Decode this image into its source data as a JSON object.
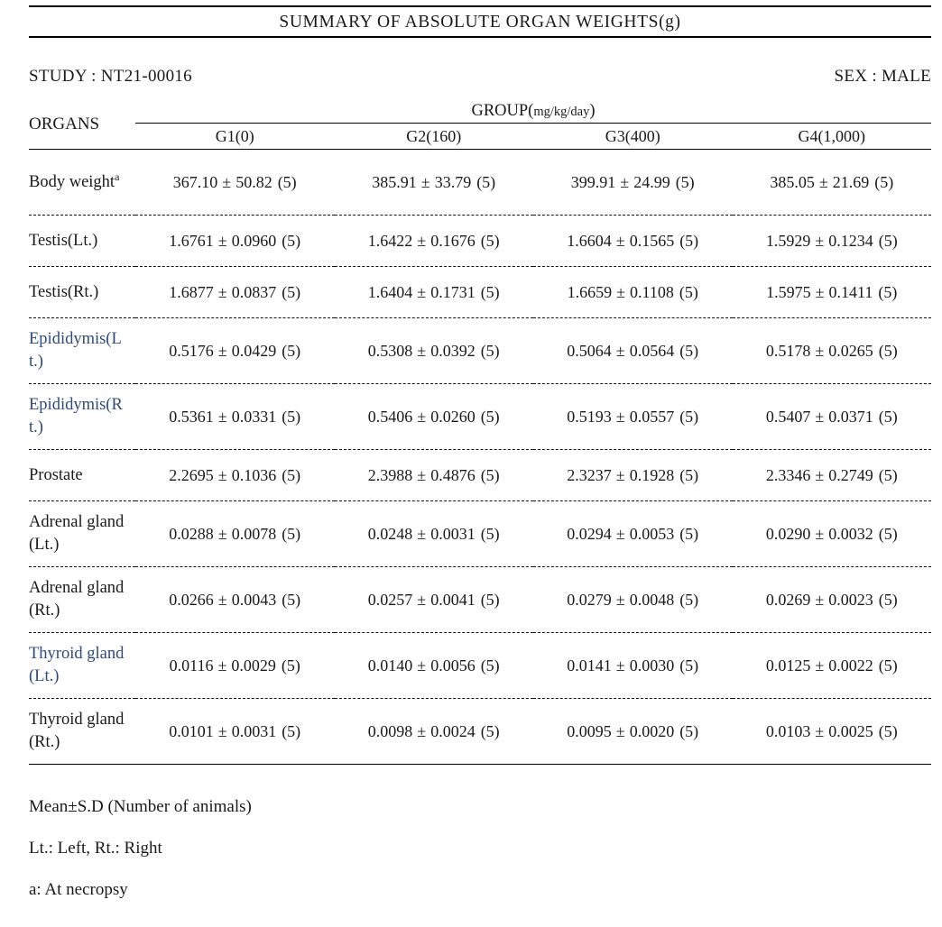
{
  "title": "SUMMARY  OF  ABSOLUTE  ORGAN  WEIGHTS(g)",
  "header": {
    "study_label": "STUDY : NT21-00016",
    "sex_label": "SEX : MALE",
    "organs_label": "ORGANS",
    "group_label": "GROUP(",
    "group_unit": "mg/kg/day",
    "group_label_end": ")",
    "columns": [
      "G1(0)",
      "G2(160)",
      "G3(400)",
      "G4(1,000)"
    ]
  },
  "colors": {
    "highlight_blue": "#2e4a7d",
    "text": "#1a1a1a"
  },
  "table": {
    "rows": [
      {
        "organ": "Body weight",
        "superscript": "a",
        "highlight": false,
        "values": [
          {
            "mean": "367.10",
            "pm": "±",
            "sd": "50.82",
            "n": "(5)"
          },
          {
            "mean": "385.91",
            "pm": "±",
            "sd": "33.79",
            "n": "(5)"
          },
          {
            "mean": "399.91",
            "pm": "±",
            "sd": "24.99",
            "n": "(5)"
          },
          {
            "mean": "385.05",
            "pm": "±",
            "sd": "21.69",
            "n": "(5)"
          }
        ]
      },
      {
        "organ": "Testis(Lt.)",
        "superscript": "",
        "highlight": false,
        "values": [
          {
            "mean": "1.6761",
            "pm": "±",
            "sd": "0.0960",
            "n": "(5)"
          },
          {
            "mean": "1.6422",
            "pm": "±",
            "sd": "0.1676",
            "n": "(5)"
          },
          {
            "mean": "1.6604",
            "pm": "±",
            "sd": "0.1565",
            "n": "(5)"
          },
          {
            "mean": "1.5929",
            "pm": "±",
            "sd": "0.1234",
            "n": "(5)"
          }
        ]
      },
      {
        "organ": "Testis(Rt.)",
        "superscript": "",
        "highlight": false,
        "values": [
          {
            "mean": "1.6877",
            "pm": "±",
            "sd": "0.0837",
            "n": "(5)"
          },
          {
            "mean": "1.6404",
            "pm": "±",
            "sd": "0.1731",
            "n": "(5)"
          },
          {
            "mean": "1.6659",
            "pm": "±",
            "sd": "0.1108",
            "n": "(5)"
          },
          {
            "mean": "1.5975",
            "pm": "±",
            "sd": "0.1411",
            "n": "(5)"
          }
        ]
      },
      {
        "organ": "Epididymis(Lt.)",
        "superscript": "",
        "highlight": true,
        "values": [
          {
            "mean": "0.5176",
            "pm": "±",
            "sd": "0.0429",
            "n": "(5)"
          },
          {
            "mean": "0.5308",
            "pm": "±",
            "sd": "0.0392",
            "n": "(5)"
          },
          {
            "mean": "0.5064",
            "pm": "±",
            "sd": "0.0564",
            "n": "(5)"
          },
          {
            "mean": "0.5178",
            "pm": "±",
            "sd": "0.0265",
            "n": "(5)"
          }
        ]
      },
      {
        "organ": "Epididymis(Rt.)",
        "superscript": "",
        "highlight": true,
        "values": [
          {
            "mean": "0.5361",
            "pm": "±",
            "sd": "0.0331",
            "n": "(5)"
          },
          {
            "mean": "0.5406",
            "pm": "±",
            "sd": "0.0260",
            "n": "(5)"
          },
          {
            "mean": "0.5193",
            "pm": "±",
            "sd": "0.0557",
            "n": "(5)"
          },
          {
            "mean": "0.5407",
            "pm": "±",
            "sd": "0.0371",
            "n": "(5)"
          }
        ]
      },
      {
        "organ": "Prostate",
        "superscript": "",
        "highlight": false,
        "values": [
          {
            "mean": "2.2695",
            "pm": "±",
            "sd": "0.1036",
            "n": "(5)"
          },
          {
            "mean": "2.3988",
            "pm": "±",
            "sd": "0.4876",
            "n": "(5)"
          },
          {
            "mean": "2.3237",
            "pm": "±",
            "sd": "0.1928",
            "n": "(5)"
          },
          {
            "mean": "2.3346",
            "pm": "±",
            "sd": "0.2749",
            "n": "(5)"
          }
        ]
      },
      {
        "organ": "Adrenal gland(Lt.)",
        "superscript": "",
        "highlight": false,
        "values": [
          {
            "mean": "0.0288",
            "pm": "±",
            "sd": "0.0078",
            "n": "(5)"
          },
          {
            "mean": "0.0248",
            "pm": "±",
            "sd": "0.0031",
            "n": "(5)"
          },
          {
            "mean": "0.0294",
            "pm": "±",
            "sd": "0.0053",
            "n": "(5)"
          },
          {
            "mean": "0.0290",
            "pm": "±",
            "sd": "0.0032",
            "n": "(5)"
          }
        ]
      },
      {
        "organ": "Adrenal gland(Rt.)",
        "superscript": "",
        "highlight": false,
        "values": [
          {
            "mean": "0.0266",
            "pm": "±",
            "sd": "0.0043",
            "n": "(5)"
          },
          {
            "mean": "0.0257",
            "pm": "±",
            "sd": "0.0041",
            "n": "(5)"
          },
          {
            "mean": "0.0279",
            "pm": "±",
            "sd": "0.0048",
            "n": "(5)"
          },
          {
            "mean": "0.0269",
            "pm": "±",
            "sd": "0.0023",
            "n": "(5)"
          }
        ]
      },
      {
        "organ": "Thyroid gland(Lt.)",
        "superscript": "",
        "highlight": true,
        "values": [
          {
            "mean": "0.0116",
            "pm": "±",
            "sd": "0.0029",
            "n": "(5)"
          },
          {
            "mean": "0.0140",
            "pm": "±",
            "sd": "0.0056",
            "n": "(5)"
          },
          {
            "mean": "0.0141",
            "pm": "±",
            "sd": "0.0030",
            "n": "(5)"
          },
          {
            "mean": "0.0125",
            "pm": "±",
            "sd": "0.0022",
            "n": "(5)"
          }
        ]
      },
      {
        "organ": "Thyroid gland(Rt.)",
        "superscript": "",
        "highlight": false,
        "values": [
          {
            "mean": "0.0101",
            "pm": "±",
            "sd": "0.0031",
            "n": "(5)"
          },
          {
            "mean": "0.0098",
            "pm": "±",
            "sd": "0.0024",
            "n": "(5)"
          },
          {
            "mean": "0.0095",
            "pm": "±",
            "sd": "0.0020",
            "n": "(5)"
          },
          {
            "mean": "0.0103",
            "pm": "±",
            "sd": "0.0025",
            "n": "(5)"
          }
        ]
      }
    ]
  },
  "footnotes": [
    "Mean±S.D  (Number of animals)",
    "Lt.: Left,  Rt.: Right",
    "a:  At necropsy"
  ]
}
